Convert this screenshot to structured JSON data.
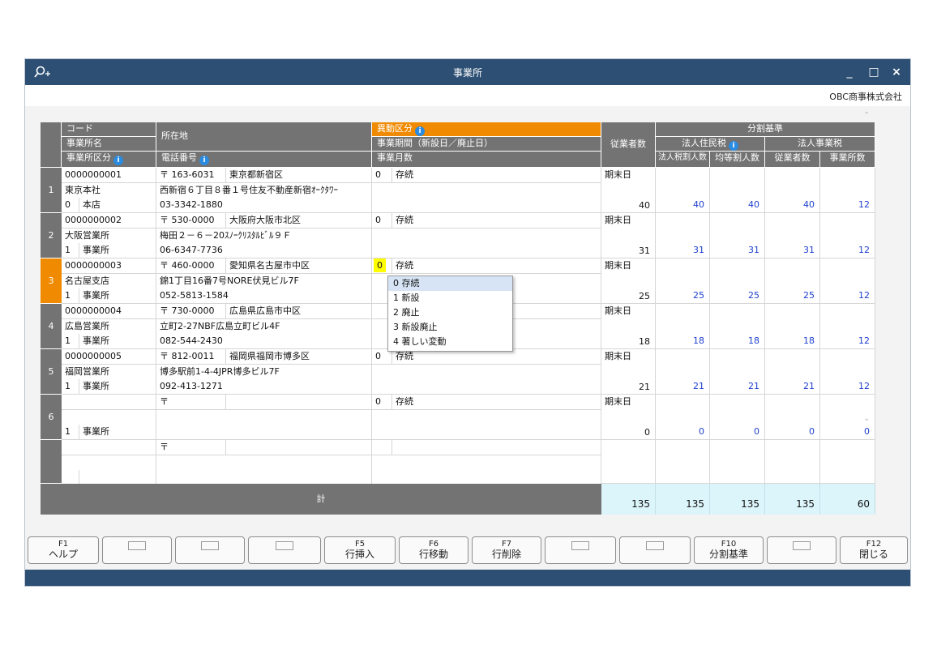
{
  "window": {
    "title": "事業所",
    "company": "OBC商事株式会社",
    "minimize": "_",
    "maximize": "□",
    "close": "×"
  },
  "headers": {
    "code": "コード",
    "name": "事業所名",
    "kubun": "事業所区分",
    "address": "所在地",
    "tel": "電話番号",
    "idou": "異動区分",
    "kikan": "事業期間（新設日／廃止日）",
    "months": "事業月数",
    "employees": "従業者数",
    "bunkatsu": "分割基準",
    "jumin": "法人住民税",
    "jigyo": "法人事業税",
    "zeiwari": "法人税割人数",
    "kinto": "均等割人数",
    "jugyosha": "従業者数",
    "jigyosho": "事業所数"
  },
  "rows": [
    {
      "no": "1",
      "code": "0000000001",
      "zip": "〒 163-6031",
      "pref": "東京都新宿区",
      "addr2": "西新宿６丁目８番１号住友不動産新宿ｵｰｸﾀﾜｰ",
      "name": "東京本社",
      "kcode": "0",
      "kname": "本店",
      "tel": "03-3342-1880",
      "icode": "0",
      "iname": "存続",
      "kimatsu": "期末日",
      "emp": "40",
      "v1": "40",
      "v2": "40",
      "v3": "40",
      "v4": "12"
    },
    {
      "no": "2",
      "code": "0000000002",
      "zip": "〒 530-0000",
      "pref": "大阪府大阪市北区",
      "addr2": "梅田２－６－20ｽﾉｰｸﾘｽﾀﾙﾋﾞﾙ９Ｆ",
      "name": "大阪営業所",
      "kcode": "1",
      "kname": "事業所",
      "tel": "06-6347-7736",
      "icode": "0",
      "iname": "存続",
      "kimatsu": "期末日",
      "emp": "31",
      "v1": "31",
      "v2": "31",
      "v3": "31",
      "v4": "12"
    },
    {
      "no": "3",
      "code": "0000000003",
      "zip": "〒 460-0000",
      "pref": "愛知県名古屋市中区",
      "addr2": "錦1丁目16番7号NORE伏見ビル7F",
      "name": "名古屋支店",
      "kcode": "1",
      "kname": "事業所",
      "tel": "052-5813-1584",
      "icode": "0",
      "iname": "存続",
      "kimatsu": "期末日",
      "emp": "25",
      "v1": "25",
      "v2": "25",
      "v3": "25",
      "v4": "12"
    },
    {
      "no": "4",
      "code": "0000000004",
      "zip": "〒 730-0000",
      "pref": "広島県広島市中区",
      "addr2": "立町2-27NBF広島立町ビル4F",
      "name": "広島営業所",
      "kcode": "1",
      "kname": "事業所",
      "tel": "082-544-2430",
      "icode": "",
      "iname": "",
      "kimatsu": "期末日",
      "emp": "18",
      "v1": "18",
      "v2": "18",
      "v3": "18",
      "v4": "12"
    },
    {
      "no": "5",
      "code": "0000000005",
      "zip": "〒 812-0011",
      "pref": "福岡県福岡市博多区",
      "addr2": "博多駅前1-4-4JPR博多ビル7F",
      "name": "福岡営業所",
      "kcode": "1",
      "kname": "事業所",
      "tel": "092-413-1271",
      "icode": "0",
      "iname": "存続",
      "kimatsu": "期末日",
      "emp": "21",
      "v1": "21",
      "v2": "21",
      "v3": "21",
      "v4": "12"
    },
    {
      "no": "6",
      "code": "",
      "zip": "〒",
      "pref": "",
      "addr2": "",
      "name": "",
      "kcode": "1",
      "kname": "事業所",
      "tel": "",
      "icode": "0",
      "iname": "存続",
      "kimatsu": "期末日",
      "emp": "0",
      "v1": "0",
      "v2": "0",
      "v3": "0",
      "v4": "0"
    }
  ],
  "blank_row_zip": "〒",
  "dropdown": [
    "0 存続",
    "1 新設",
    "2 廃止",
    "3 新設廃止",
    "4 著しい変動"
  ],
  "total": {
    "label": "計",
    "emp": "135",
    "v1": "135",
    "v2": "135",
    "v3": "135",
    "v4": "60"
  },
  "fkeys": {
    "f1_code": "F1",
    "f1_label": "ヘルプ",
    "f5_code": "F5",
    "f5_label": "行挿入",
    "f6_code": "F6",
    "f6_label": "行移動",
    "f7_code": "F7",
    "f7_label": "行削除",
    "f10_code": "F10",
    "f10_label": "分割基準",
    "f12_code": "F12",
    "f12_label": "閉じる"
  }
}
